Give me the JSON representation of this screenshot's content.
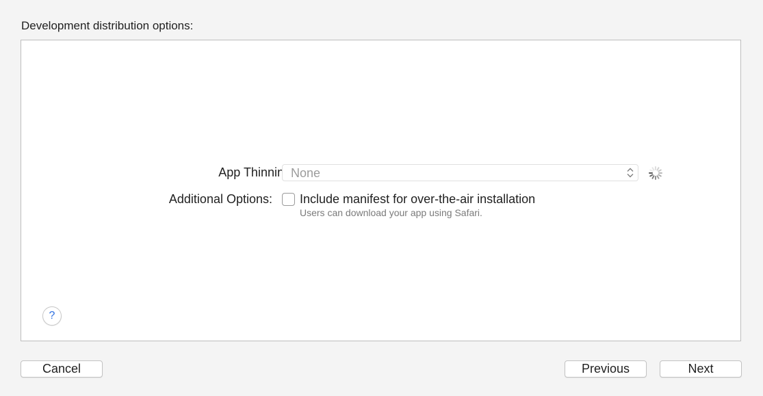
{
  "header": {
    "title": "Development distribution options:"
  },
  "form": {
    "app_thinning": {
      "label": "App Thinning:",
      "selected_value": "None",
      "arrows_icon": "up-down-chevrons",
      "loading_icon": "spinner"
    },
    "additional_options": {
      "label": "Additional Options:",
      "checkbox_checked": false,
      "checkbox_label": "Include manifest for over-the-air installation",
      "checkbox_help": "Users can download your app using Safari."
    }
  },
  "help": {
    "symbol": "?"
  },
  "footer": {
    "cancel_label": "Cancel",
    "previous_label": "Previous",
    "next_label": "Next"
  },
  "colors": {
    "background": "#f4f4f4",
    "panel": "#ffffff",
    "help_accent": "#2d6fe0",
    "placeholder_text": "#9b9b9b"
  }
}
